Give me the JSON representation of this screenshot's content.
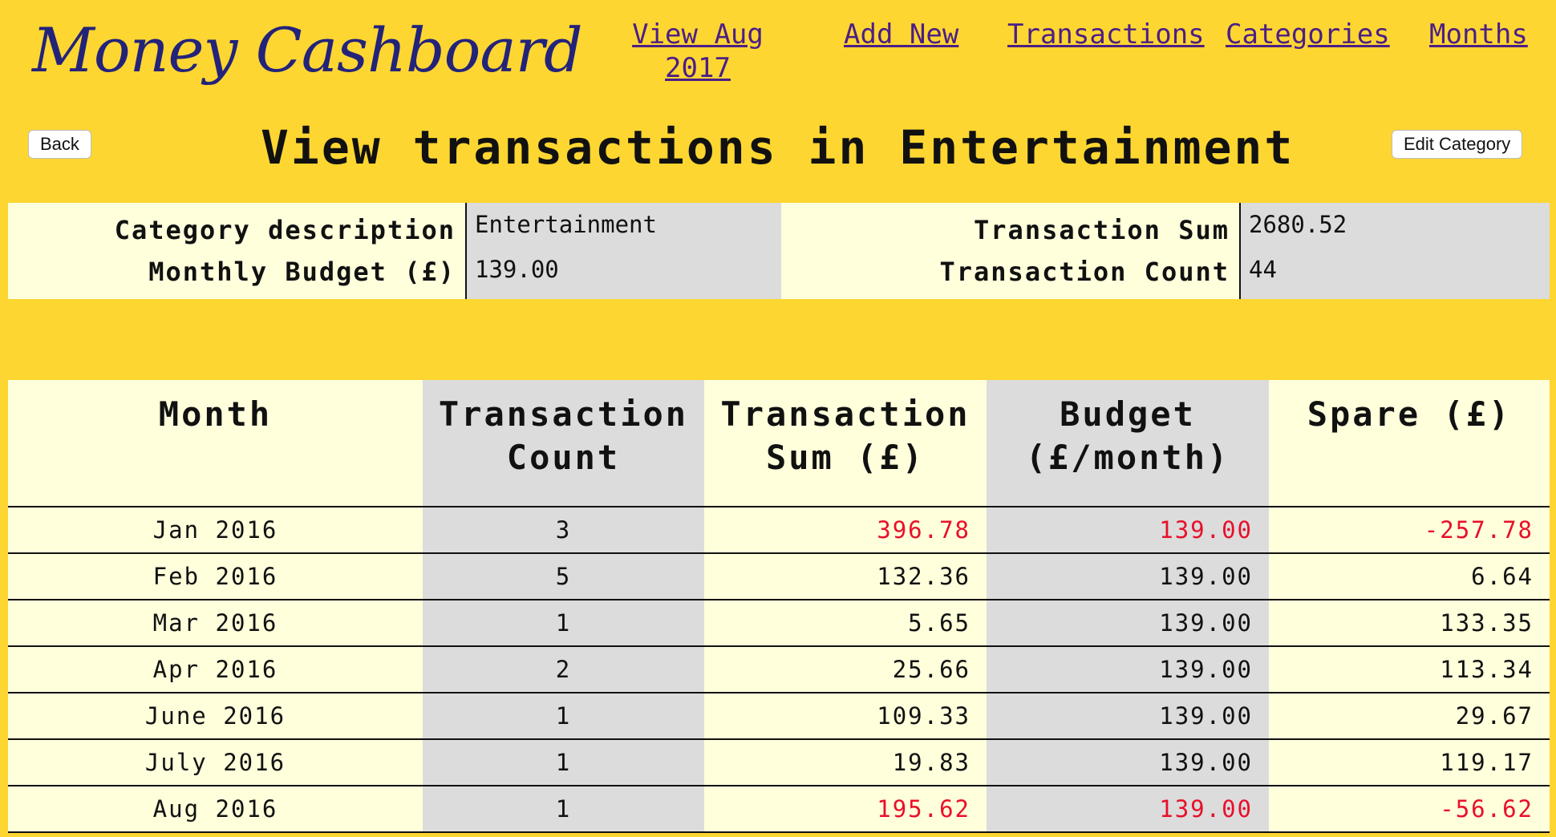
{
  "app": {
    "logo": "Money Cashboard"
  },
  "nav": {
    "view_month": "View Aug 2017",
    "add_new": "Add New",
    "transactions": "Transactions",
    "categories": "Categories",
    "months": "Months"
  },
  "buttons": {
    "back": "Back",
    "edit_category": "Edit Category"
  },
  "page_title": "View transactions in Entertainment",
  "summary": {
    "category_description_label": "Category description",
    "category_description": "Entertainment",
    "monthly_budget_label": "Monthly Budget (£)",
    "monthly_budget": "139.00",
    "transaction_sum_label": "Transaction Sum",
    "transaction_sum": "2680.52",
    "transaction_count_label": "Transaction Count",
    "transaction_count": "44"
  },
  "table": {
    "headers": [
      "Month",
      "Transaction Count",
      "Transaction Sum (£)",
      "Budget (£/month)",
      "Spare (£)"
    ],
    "rows": [
      {
        "month": "Jan 2016",
        "count": "3",
        "sum": "396.78",
        "budget": "139.00",
        "spare": "-257.78",
        "over": true
      },
      {
        "month": "Feb 2016",
        "count": "5",
        "sum": "132.36",
        "budget": "139.00",
        "spare": "6.64",
        "over": false
      },
      {
        "month": "Mar 2016",
        "count": "1",
        "sum": "5.65",
        "budget": "139.00",
        "spare": "133.35",
        "over": false
      },
      {
        "month": "Apr 2016",
        "count": "2",
        "sum": "25.66",
        "budget": "139.00",
        "spare": "113.34",
        "over": false
      },
      {
        "month": "June 2016",
        "count": "1",
        "sum": "109.33",
        "budget": "139.00",
        "spare": "29.67",
        "over": false
      },
      {
        "month": "July 2016",
        "count": "1",
        "sum": "19.83",
        "budget": "139.00",
        "spare": "119.17",
        "over": false
      },
      {
        "month": "Aug 2016",
        "count": "1",
        "sum": "195.62",
        "budget": "139.00",
        "spare": "-56.62",
        "over": true
      }
    ]
  },
  "colors": {
    "background": "#fed631",
    "panel_light": "#ffffdc",
    "panel_grey": "#dcdcdc",
    "link": "#4b1f86",
    "logo": "#23237a",
    "over_budget": "#e8102a"
  }
}
